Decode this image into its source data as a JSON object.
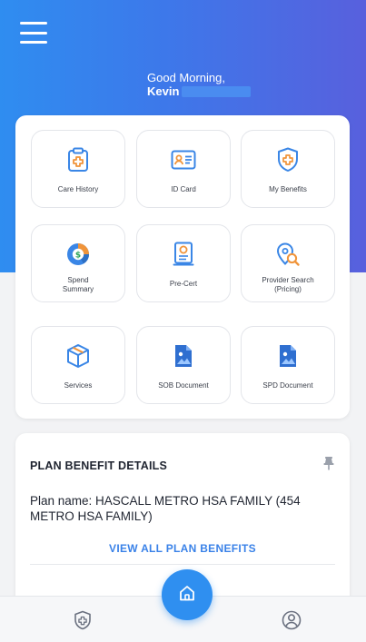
{
  "header": {
    "greeting": "Good Morning,",
    "user_name": "Kevin"
  },
  "tiles": [
    {
      "label": "Care History",
      "icon": "clipboard-medical-icon"
    },
    {
      "label": "ID Card",
      "icon": "id-card-icon"
    },
    {
      "label": "My Benefits",
      "icon": "shield-plus-icon"
    },
    {
      "label": "Spend\nSummary",
      "icon": "pie-chart-dollar-icon"
    },
    {
      "label": "Pre-Cert",
      "icon": "certificate-icon"
    },
    {
      "label": "Provider Search\n(Pricing)",
      "icon": "location-search-icon"
    },
    {
      "label": "Services",
      "icon": "box-icon"
    },
    {
      "label": "SOB Document",
      "icon": "image-document-icon"
    },
    {
      "label": "SPD Document",
      "icon": "image-document-icon"
    }
  ],
  "plan": {
    "title": "PLAN BENEFIT DETAILS",
    "plan_name": "Plan name: HASCALL METRO HSA FAMILY (454 METRO HSA FAMILY)",
    "view_all_label": "VIEW ALL PLAN BENEFITS"
  },
  "bottom_nav": {
    "left_icon": "shield-plus-icon",
    "center_icon": "home-icon",
    "right_icon": "profile-icon"
  },
  "colors": {
    "accent": "#2f8ff0",
    "icon_blue": "#3a86e6",
    "icon_orange": "#f0943a"
  }
}
